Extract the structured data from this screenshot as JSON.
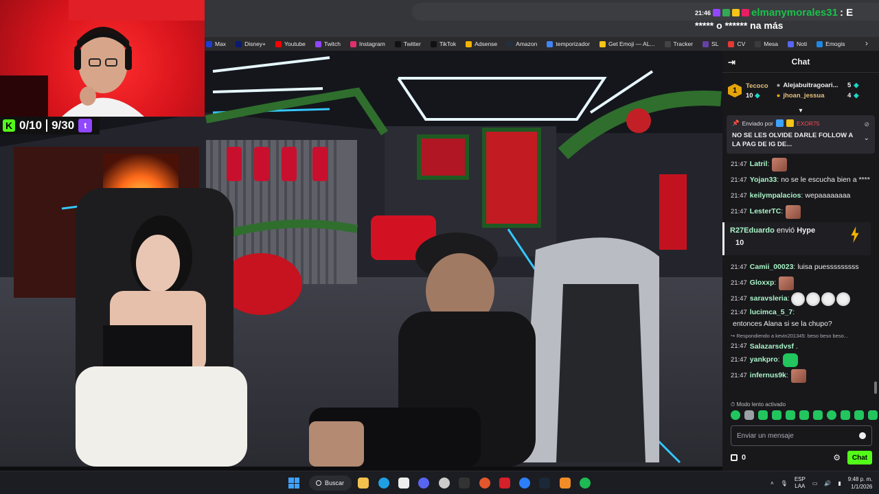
{
  "bookmarks": [
    {
      "label": "Max",
      "color": "#1c3ed1"
    },
    {
      "label": "Disney+",
      "color": "#0a1a70"
    },
    {
      "label": "Youtube",
      "color": "#ff0000"
    },
    {
      "label": "Twitch",
      "color": "#9146ff"
    },
    {
      "label": "Instagram",
      "color": "#e1306c"
    },
    {
      "label": "Twitter",
      "color": "#111111"
    },
    {
      "label": "TikTok",
      "color": "#111111"
    },
    {
      "label": "Adsense",
      "color": "#f4b400"
    },
    {
      "label": "Amazon",
      "color": "#232f3e"
    },
    {
      "label": "temporizador",
      "color": "#4285f4"
    },
    {
      "label": "Get Emoji — AL...",
      "color": "#f5c518"
    },
    {
      "label": "Tracker",
      "color": "#444444"
    },
    {
      "label": "SL",
      "color": "#6441a5"
    },
    {
      "label": "CV",
      "color": "#e53935"
    },
    {
      "label": "Mesa",
      "color": "#3b3b3b"
    },
    {
      "label": "Noti",
      "color": "#5865f2"
    },
    {
      "label": "Emogis",
      "color": "#1e88e5"
    }
  ],
  "webcam": {
    "kick_logo": "K",
    "kick_count": "0/10",
    "twitch_count": "9/30",
    "twitch_logo": "t"
  },
  "overlay_chat": {
    "time": "21:46",
    "username": "elmanymorales31",
    "message": ": E",
    "line2": "***** o ****** na más",
    "username_color": "#19c24a"
  },
  "chat": {
    "title": "Chat",
    "leaderboard": {
      "rank": "1",
      "top_user": "Tecoco",
      "top_count": "10",
      "entries": [
        {
          "name": "Alejabuitragoari...",
          "count": "5"
        },
        {
          "name": "jhoan_jessua",
          "count": "4"
        }
      ]
    },
    "pinned": {
      "sent_by_label": "Enviado por",
      "sent_by_user": "EXOR75",
      "text": "NO SE LES OLVIDE DARLE FOLLOW A LA PAG DE IG DE..."
    },
    "messages_top": [
      {
        "ts": "21:47",
        "user": "Latril",
        "text": "",
        "emotes": [
          "face"
        ]
      },
      {
        "ts": "21:47",
        "user": "Yojan33",
        "text": "no se le escucha bien a ****",
        "emotes": []
      },
      {
        "ts": "21:47",
        "user": "keilympalacios",
        "text": "wepaaaaaaaa",
        "emotes": []
      },
      {
        "ts": "21:47",
        "user": "LesterTC",
        "text": "",
        "emotes": [
          "face"
        ]
      }
    ],
    "hype": {
      "user": "R27Eduardo",
      "action": "envió",
      "item": "Hype",
      "amount": "10"
    },
    "messages_bottom": [
      {
        "ts": "21:47",
        "user": "Camii_00023",
        "text": "luisa puesssssssss",
        "emotes": []
      },
      {
        "ts": "21:47",
        "user": "Gloxxp",
        "text": "",
        "emotes": [
          "face"
        ]
      },
      {
        "ts": "21:47",
        "user": "saravsleria",
        "text": "",
        "emotes": [
          "round",
          "round",
          "round",
          "round"
        ]
      },
      {
        "ts": "21:47",
        "user": "lucimca_5_7",
        "text": "entonces Alana si se la chupo?",
        "emotes": []
      }
    ],
    "reply": {
      "line": "Respondiendo a kevin201345: beso beso beso...",
      "ts": "21:47",
      "user": "Salazarsdvsf",
      "text": "."
    },
    "messages_end": [
      {
        "ts": "21:47",
        "user": "yankpro",
        "text": "",
        "emotes": [
          "green"
        ]
      },
      {
        "ts": "21:47",
        "user": "infernus9k",
        "text": "",
        "emotes": [
          "face"
        ]
      }
    ],
    "slow_mode": "Modo lento activado",
    "input_placeholder": "Enviar un mensaje",
    "points": "0",
    "send_label": "Chat"
  },
  "taskbar": {
    "search_label": "Buscar",
    "lang_line1": "ESP",
    "lang_line2": "LAA",
    "time": "9:48 p. m.",
    "date": "1/1/2026"
  },
  "colors": {
    "accent": "#53fc18",
    "username": "#a9f5c8",
    "twitch": "#9146ff"
  }
}
